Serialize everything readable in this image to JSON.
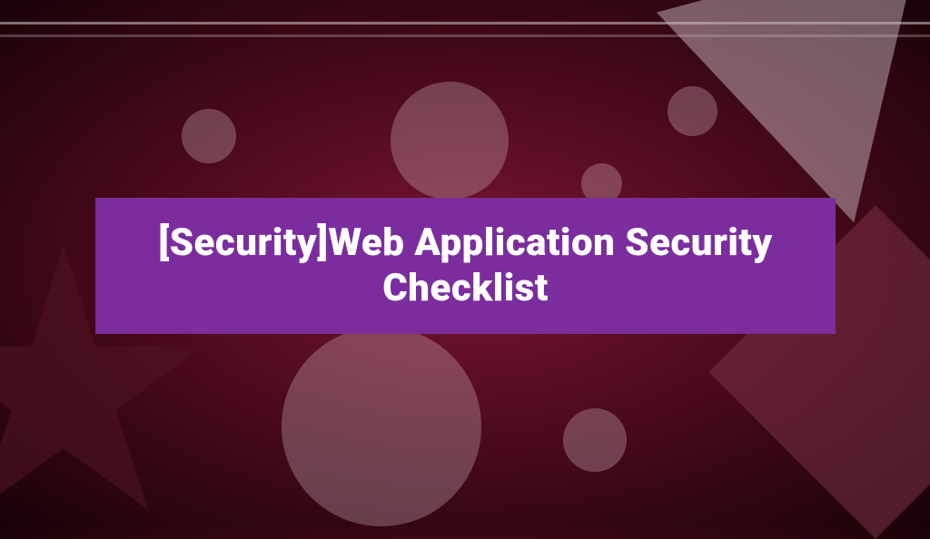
{
  "banner": {
    "title": "[Security]Web Application Security Checklist"
  },
  "colors": {
    "banner_bg": "#7b2d9e",
    "banner_text": "#ffffff"
  }
}
